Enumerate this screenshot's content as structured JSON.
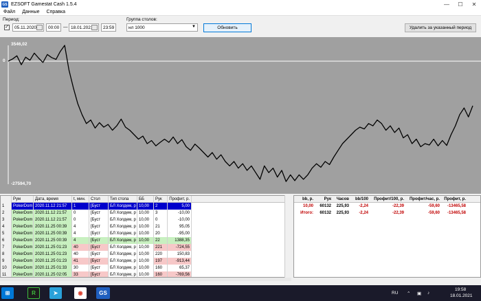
{
  "window": {
    "title": "EZSOFT Gamestat Cash 1.5.4",
    "app_icon_text": "GS"
  },
  "menu": [
    "Файл",
    "Данные",
    "Справка"
  ],
  "toolbar": {
    "period_label": "Период:",
    "date_from": "05.11.2020",
    "time_from": "00:00",
    "dash": "—",
    "date_to": "18.01.2021",
    "time_to": "23:59",
    "group_label": "Группа столов:",
    "group_value": "нл 1000",
    "refresh_button": "Обновить",
    "delete_button": "Удалить за указанный период"
  },
  "chart_data": {
    "type": "line",
    "title": "",
    "xlabel": "",
    "ylabel": "",
    "y_max_label": "3546,02",
    "y_min_label": "-27594,70",
    "zero_label": "0",
    "ylim": [
      -27594.7,
      3546.02
    ],
    "series": [
      {
        "values": [
          0,
          500,
          1200,
          -800,
          900,
          200,
          1800,
          700,
          -300,
          1500,
          800,
          400,
          2200,
          3546,
          -2000,
          -6000,
          -9500,
          -12000,
          -14000,
          -13200,
          -15000,
          -13800,
          -14800,
          -14200,
          -15500,
          -14500,
          -13000,
          -14800,
          -15500,
          -16500,
          -17500,
          -16800,
          -18500,
          -17800,
          -19000,
          -18200,
          -17500,
          -18200,
          -17000,
          -18500,
          -17600,
          -19200,
          -20000,
          -18600,
          -19500,
          -20500,
          -21500,
          -20500,
          -22000,
          -21000,
          -22500,
          -23500,
          -22500,
          -24000,
          -23000,
          -24500,
          -23500,
          -25000,
          -26500,
          -23500,
          -25000,
          -24000,
          -26000,
          -24500,
          -27000,
          -25500,
          -26800,
          -25500,
          -26500,
          -25500,
          -24000,
          -23000,
          -23800,
          -22500,
          -23200,
          -21500,
          -20000,
          -18500,
          -17500,
          -16500,
          -15500,
          -14800,
          -15200,
          -14000,
          -14500,
          -13200,
          -14000,
          -15500,
          -14500,
          -16000,
          -15000,
          -17200,
          -16500,
          -18500,
          -17500,
          -19200,
          -18500,
          -18800,
          -17500,
          -19000,
          -17800,
          -18900,
          -16500,
          -14500,
          -12000,
          -10500,
          -12500,
          -10000
        ]
      }
    ]
  },
  "left_grid": {
    "headers": [
      "",
      "Рум",
      "Дата, время",
      "t, мин.",
      "Стол",
      "Тип стола",
      "ББ",
      "Рук",
      "Профит, р."
    ],
    "rows": [
      {
        "n": "1",
        "room": "PokerDom",
        "date": "2020.11.12  21:57",
        "t": "1",
        "table": "[Буст",
        "type": "БЛ Холдем, р",
        "bb": "10,00",
        "hands": "2",
        "profit": "5,00",
        "style": "blue"
      },
      {
        "n": "2",
        "room": "PokerDom",
        "date": "2020.11.12  21:57",
        "t": "0",
        "table": "[Буст",
        "type": "БЛ Холдем, р",
        "bb": "10,00",
        "hands": "3",
        "profit": "-10,00",
        "style": ""
      },
      {
        "n": "3",
        "room": "PokerDom",
        "date": "2020.11.12  21:57",
        "t": "0",
        "table": "[Буст",
        "type": "БЛ Холдем, р",
        "bb": "10,00",
        "hands": "0",
        "profit": "-10,00",
        "style": ""
      },
      {
        "n": "4",
        "room": "PokerDom",
        "date": "2020.11.25  00:39",
        "t": "4",
        "table": "[Буст",
        "type": "БЛ Холдем, р",
        "bb": "10,00",
        "hands": "21",
        "profit": "95,05",
        "style": ""
      },
      {
        "n": "5",
        "room": "PokerDom",
        "date": "2020.11.25  00:39",
        "t": "4",
        "table": "[Буст",
        "type": "БЛ Холдем, р",
        "bb": "10,00",
        "hands": "20",
        "profit": "-95,00",
        "style": ""
      },
      {
        "n": "6",
        "room": "PokerDom",
        "date": "2020.11.25  00:39",
        "t": "4",
        "table": "[Буст",
        "type": "БЛ Холдем, р",
        "bb": "10,00",
        "hands": "22",
        "profit": "1388,35",
        "style": "green"
      },
      {
        "n": "7",
        "room": "PokerDom",
        "date": "2020.11.25  01:23",
        "t": "40",
        "table": "[Буст",
        "type": "БЛ Холдем, р",
        "bb": "10,00",
        "hands": "221",
        "profit": "-724,55",
        "style": "pink"
      },
      {
        "n": "8",
        "room": "PokerDom",
        "date": "2020.11.25  01:23",
        "t": "40",
        "table": "[Буст",
        "type": "БЛ Холдем, р",
        "bb": "10,00",
        "hands": "220",
        "profit": "150,83",
        "style": ""
      },
      {
        "n": "9",
        "room": "PokerDom",
        "date": "2020.11.25  01:23",
        "t": "41",
        "table": "[Буст",
        "type": "БЛ Холдем, р",
        "bb": "10,00",
        "hands": "197",
        "profit": "-913,44",
        "style": "pink"
      },
      {
        "n": "10",
        "room": "PokerDom",
        "date": "2020.11.25  01:33",
        "t": "30",
        "table": "[Буст",
        "type": "БЛ Холдем, р",
        "bb": "10,00",
        "hands": "160",
        "profit": "65,37",
        "style": ""
      },
      {
        "n": "11",
        "room": "PokerDom",
        "date": "2020.11.25  02:05",
        "t": "33",
        "table": "[Буст",
        "type": "БЛ Холдем, р",
        "bb": "10,00",
        "hands": "160",
        "profit": "-769,56",
        "style": "pink"
      }
    ]
  },
  "right_grid": {
    "headers": [
      "bb, р.",
      "Рук",
      "Часов",
      "bb/100",
      "Профит/100, р.",
      "Профит/час, р.",
      "Профит, р."
    ],
    "rows": [
      {
        "label": "",
        "bb": "10,00",
        "hands": "60132",
        "hours": "225,93",
        "bb100": "-2,24",
        "p100": "-22,39",
        "phour": "-59,60",
        "profit": "-13465,58"
      },
      {
        "label": "Итого:",
        "bb": "",
        "hands": "60132",
        "hours": "225,93",
        "bb100": "-2,24",
        "p100": "-22,39",
        "phour": "-59,60",
        "profit": "-13465,58"
      }
    ]
  },
  "taskbar": {
    "apps": [
      "R",
      "➤",
      "◉",
      "GS"
    ],
    "lang": "RU",
    "time": "19:58",
    "date": "18.01.2021"
  }
}
